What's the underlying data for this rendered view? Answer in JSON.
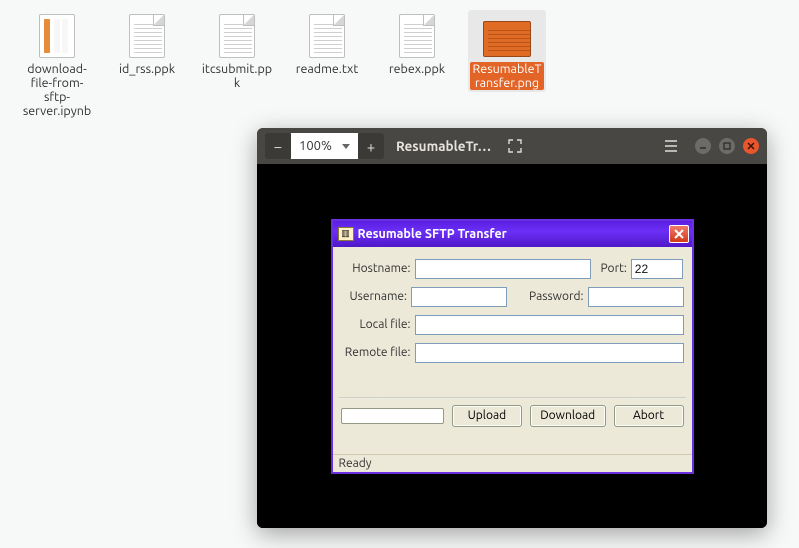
{
  "desktop": {
    "files": [
      {
        "name": "download-file-from-sftp-server.ipynb",
        "type": "notebook",
        "selected": false
      },
      {
        "name": "id_rss.ppk",
        "type": "text",
        "selected": false
      },
      {
        "name": "itcsubmit.ppk",
        "type": "text",
        "selected": false
      },
      {
        "name": "readme.txt",
        "type": "text",
        "selected": false
      },
      {
        "name": "rebex.ppk",
        "type": "text",
        "selected": false
      },
      {
        "name": "ResumableTransfer.png",
        "type": "thumb",
        "selected": true
      }
    ]
  },
  "viewer": {
    "zoom_value": "100%",
    "title": "ResumableTr…",
    "minus": "−",
    "plus": "+"
  },
  "dialog": {
    "title": "Resumable SFTP Transfer",
    "hostname_label": "Hostname:",
    "hostname_value": "",
    "port_label": "Port:",
    "port_value": "22",
    "username_label": "Username:",
    "username_value": "",
    "password_label": "Password:",
    "password_value": "",
    "localfile_label": "Local file:",
    "localfile_value": "",
    "remotefile_label": "Remote file:",
    "remotefile_value": "",
    "upload_label": "Upload",
    "download_label": "Download",
    "abort_label": "Abort",
    "status": "Ready"
  }
}
